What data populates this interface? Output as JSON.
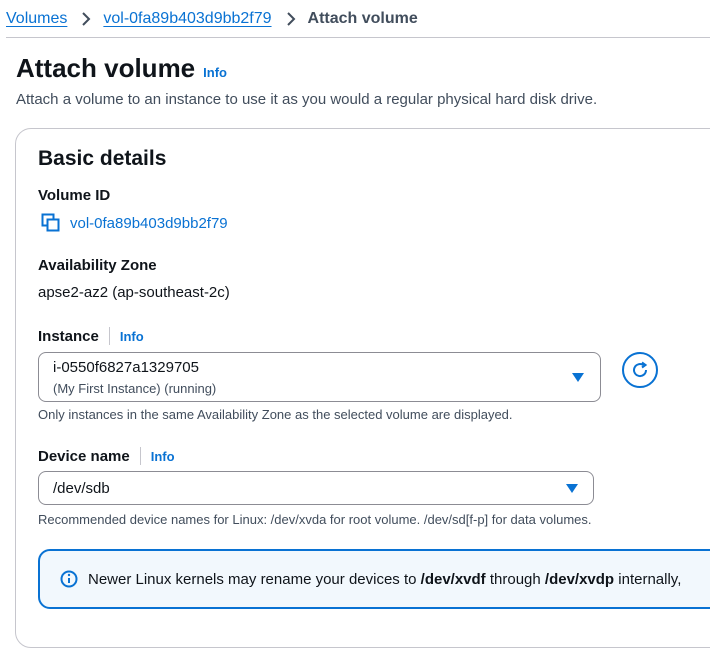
{
  "breadcrumb": {
    "items": [
      "Volumes",
      "vol-0fa89b403d9bb2f79"
    ],
    "current": "Attach volume"
  },
  "header": {
    "title": "Attach volume",
    "info": "Info",
    "description": "Attach a volume to an instance to use it as you would a regular physical hard disk drive."
  },
  "basic": {
    "title": "Basic details",
    "volume_id_label": "Volume ID",
    "volume_id": "vol-0fa89b403d9bb2f79",
    "az_label": "Availability Zone",
    "az_value": "apse2-az2 (ap-southeast-2c)",
    "instance_label": "Instance",
    "instance_info": "Info",
    "instance_value": "i-0550f6827a1329705",
    "instance_sub": "(My First Instance) (running)",
    "instance_hint": "Only instances in the same Availability Zone as the selected volume are displayed.",
    "device_label": "Device name",
    "device_info": "Info",
    "device_value": "/dev/sdb",
    "device_hint": "Recommended device names for Linux: /dev/xvda for root volume. /dev/sd[f-p] for data volumes."
  },
  "alert": {
    "prefix": "Newer Linux kernels may rename your devices to ",
    "dev1": "/dev/xvdf",
    "middle": " through ",
    "dev2": "/dev/xvdp",
    "suffix": " internally,"
  },
  "colors": {
    "link": "#0972d3",
    "border": "#c6c6cd",
    "alert_bg": "#f2f8fd"
  },
  "icons": [
    "chevron-right-icon",
    "copy-icon",
    "caret-down-icon",
    "refresh-icon",
    "info-circle-icon"
  ]
}
